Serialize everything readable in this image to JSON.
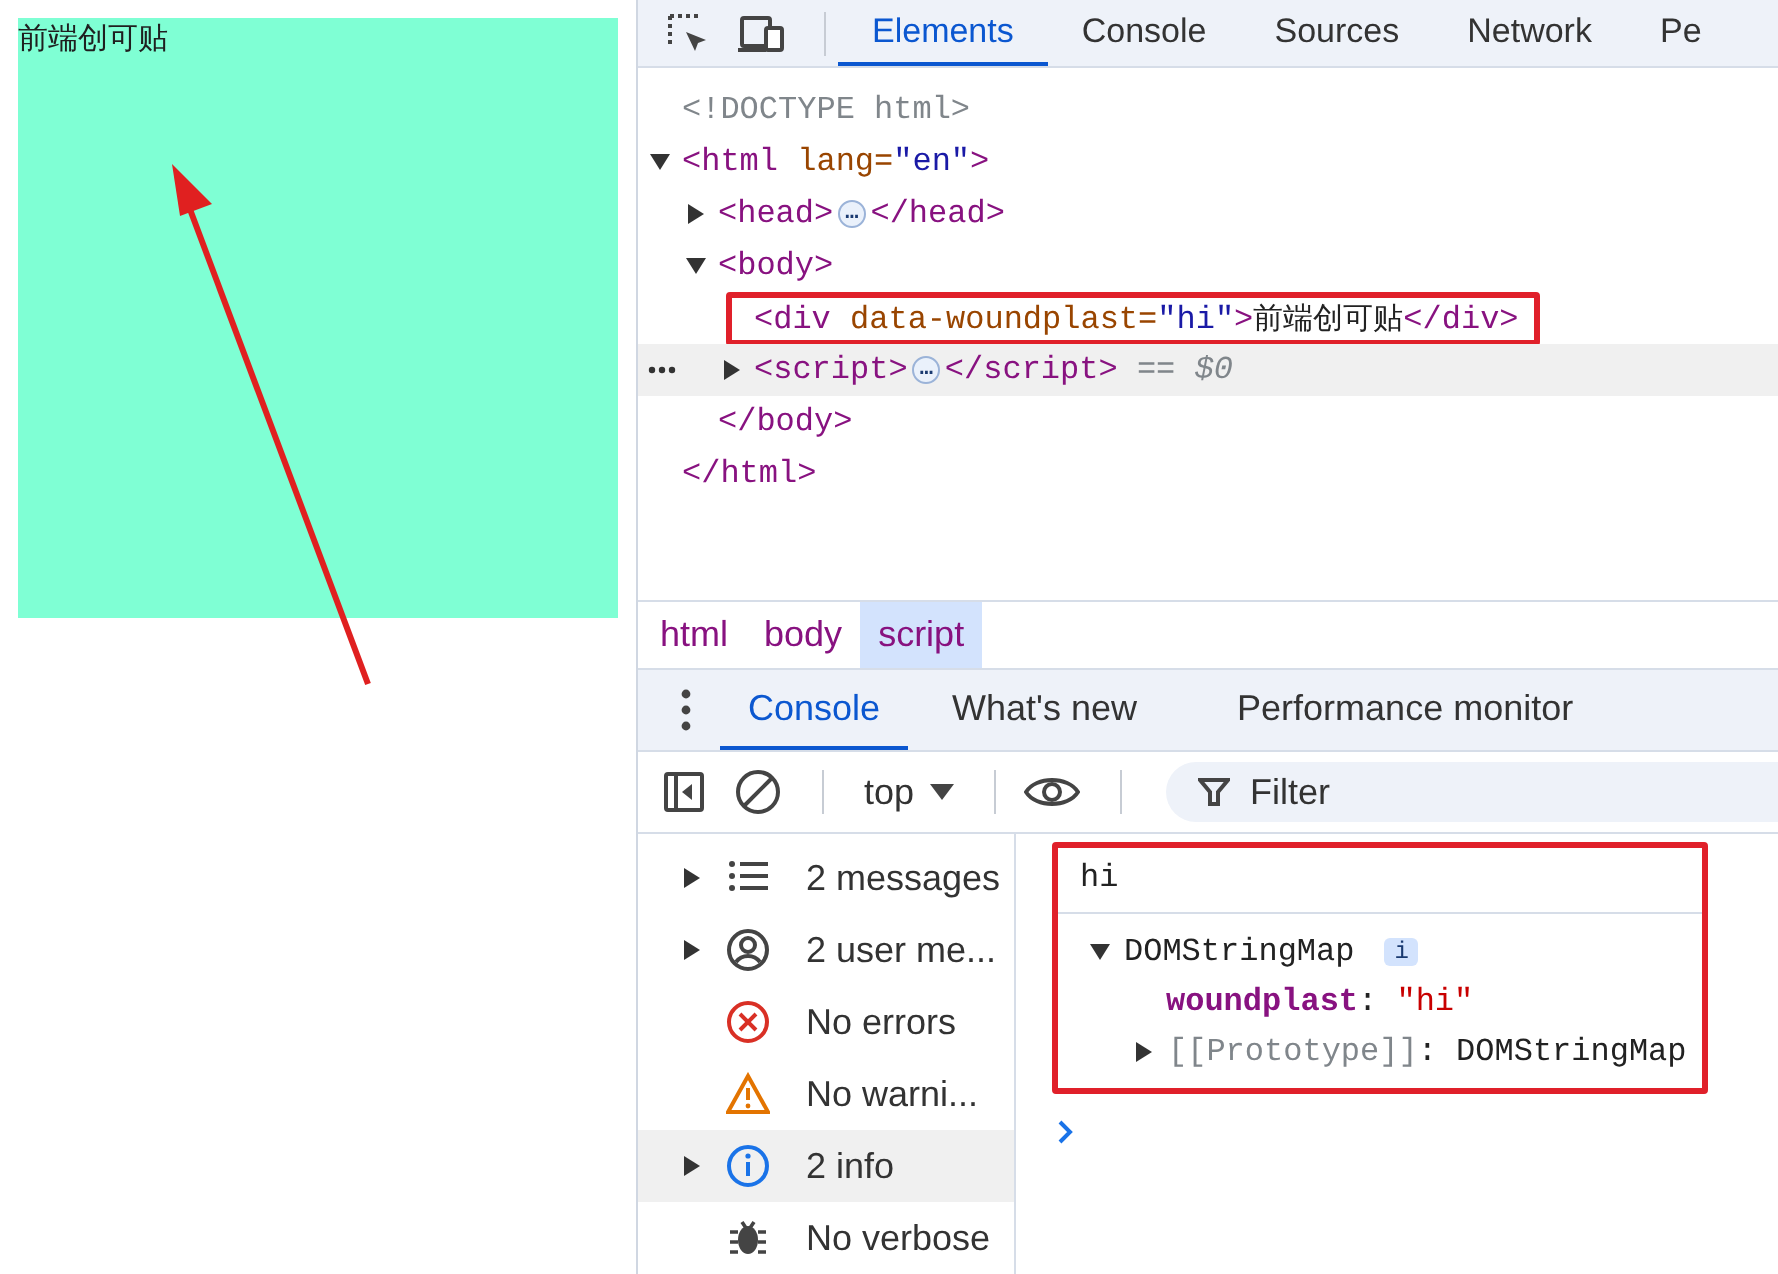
{
  "page": {
    "text": "前端创可贴",
    "annotation_arrow": true
  },
  "devtools": {
    "tabs": [
      {
        "label": "Elements",
        "selected": true
      },
      {
        "label": "Console",
        "selected": false
      },
      {
        "label": "Sources",
        "selected": false
      },
      {
        "label": "Network",
        "selected": false
      },
      {
        "label": "Pe",
        "selected": false
      }
    ],
    "dom_tree": [
      {
        "parts": [
          {
            "kind": "doctype",
            "text": "<!DOCTYPE html>"
          }
        ],
        "selected": false,
        "annotated": false
      },
      {
        "parts": [
          {
            "kind": "tag",
            "text": "<html"
          },
          {
            "kind": "attr",
            "text": " lang="
          },
          {
            "kind": "value",
            "text": "\"en\""
          },
          {
            "kind": "tag",
            "text": ">"
          }
        ],
        "selected": false,
        "annotated": false,
        "expanded": true,
        "close_parts": [
          {
            "kind": "tag",
            "text": "</html>"
          }
        ],
        "children": [
          {
            "parts": [
              {
                "kind": "tag",
                "text": "<head>"
              },
              {
                "kind": "pill",
                "text": "…"
              },
              {
                "kind": "tag",
                "text": "</head>"
              }
            ],
            "expanded": false,
            "selected": false,
            "annotated": false
          },
          {
            "parts": [
              {
                "kind": "tag",
                "text": "<body>"
              }
            ],
            "expanded": true,
            "selected": false,
            "annotated": false,
            "close_parts": [
              {
                "kind": "tag",
                "text": "</body>"
              }
            ],
            "children": [
              {
                "parts": [
                  {
                    "kind": "tag",
                    "text": "<div"
                  },
                  {
                    "kind": "attr",
                    "text": " data-woundplast="
                  },
                  {
                    "kind": "value",
                    "text": "\"hi\""
                  },
                  {
                    "kind": "tag",
                    "text": ">"
                  },
                  {
                    "kind": "text",
                    "text": "前端创可贴"
                  },
                  {
                    "kind": "tag",
                    "text": "</div>"
                  }
                ],
                "selected": false,
                "annotated": true
              },
              {
                "parts": [
                  {
                    "kind": "tag",
                    "text": "<script>"
                  },
                  {
                    "kind": "pill",
                    "text": "…"
                  },
                  {
                    "kind": "tag",
                    "text": "</script>"
                  },
                  {
                    "kind": "hint",
                    "text": " == $0"
                  }
                ],
                "expanded": false,
                "selected": true,
                "annotated": false
              }
            ]
          }
        ]
      }
    ],
    "breadcrumbs": [
      {
        "label": "html",
        "selected": false
      },
      {
        "label": "body",
        "selected": false
      },
      {
        "label": "script",
        "selected": true
      }
    ],
    "drawer_tabs": [
      {
        "label": "Console",
        "selected": true
      },
      {
        "label": "What's new",
        "selected": false
      },
      {
        "label": "Performance monitor",
        "selected": false
      }
    ],
    "console_toolbar": {
      "context": "top",
      "filter_placeholder": "Filter"
    },
    "sidebar": [
      {
        "label": "2 messages",
        "kind": "list",
        "expandable": true,
        "selected": false
      },
      {
        "label": "2 user me...",
        "kind": "user",
        "expandable": true,
        "selected": false
      },
      {
        "label": "No errors",
        "kind": "error",
        "expandable": false,
        "selected": false
      },
      {
        "label": "No warni...",
        "kind": "warning",
        "expandable": false,
        "selected": false
      },
      {
        "label": "2 info",
        "kind": "info",
        "expandable": true,
        "selected": true
      },
      {
        "label": "No verbose",
        "kind": "verbose",
        "expandable": false,
        "selected": false
      }
    ],
    "console_output": {
      "annotated": true,
      "messages": [
        {
          "kind": "log",
          "text": "hi"
        },
        {
          "kind": "object",
          "label": "DOMStringMap",
          "badge": "i",
          "expanded": true,
          "properties": [
            {
              "key": "woundplast",
              "separator": ":",
              "value": "\"hi\""
            }
          ],
          "prototype": {
            "key": "[[Prototype]]",
            "separator": ":",
            "value": "DOMStringMap",
            "expanded": false
          }
        }
      ]
    }
  }
}
